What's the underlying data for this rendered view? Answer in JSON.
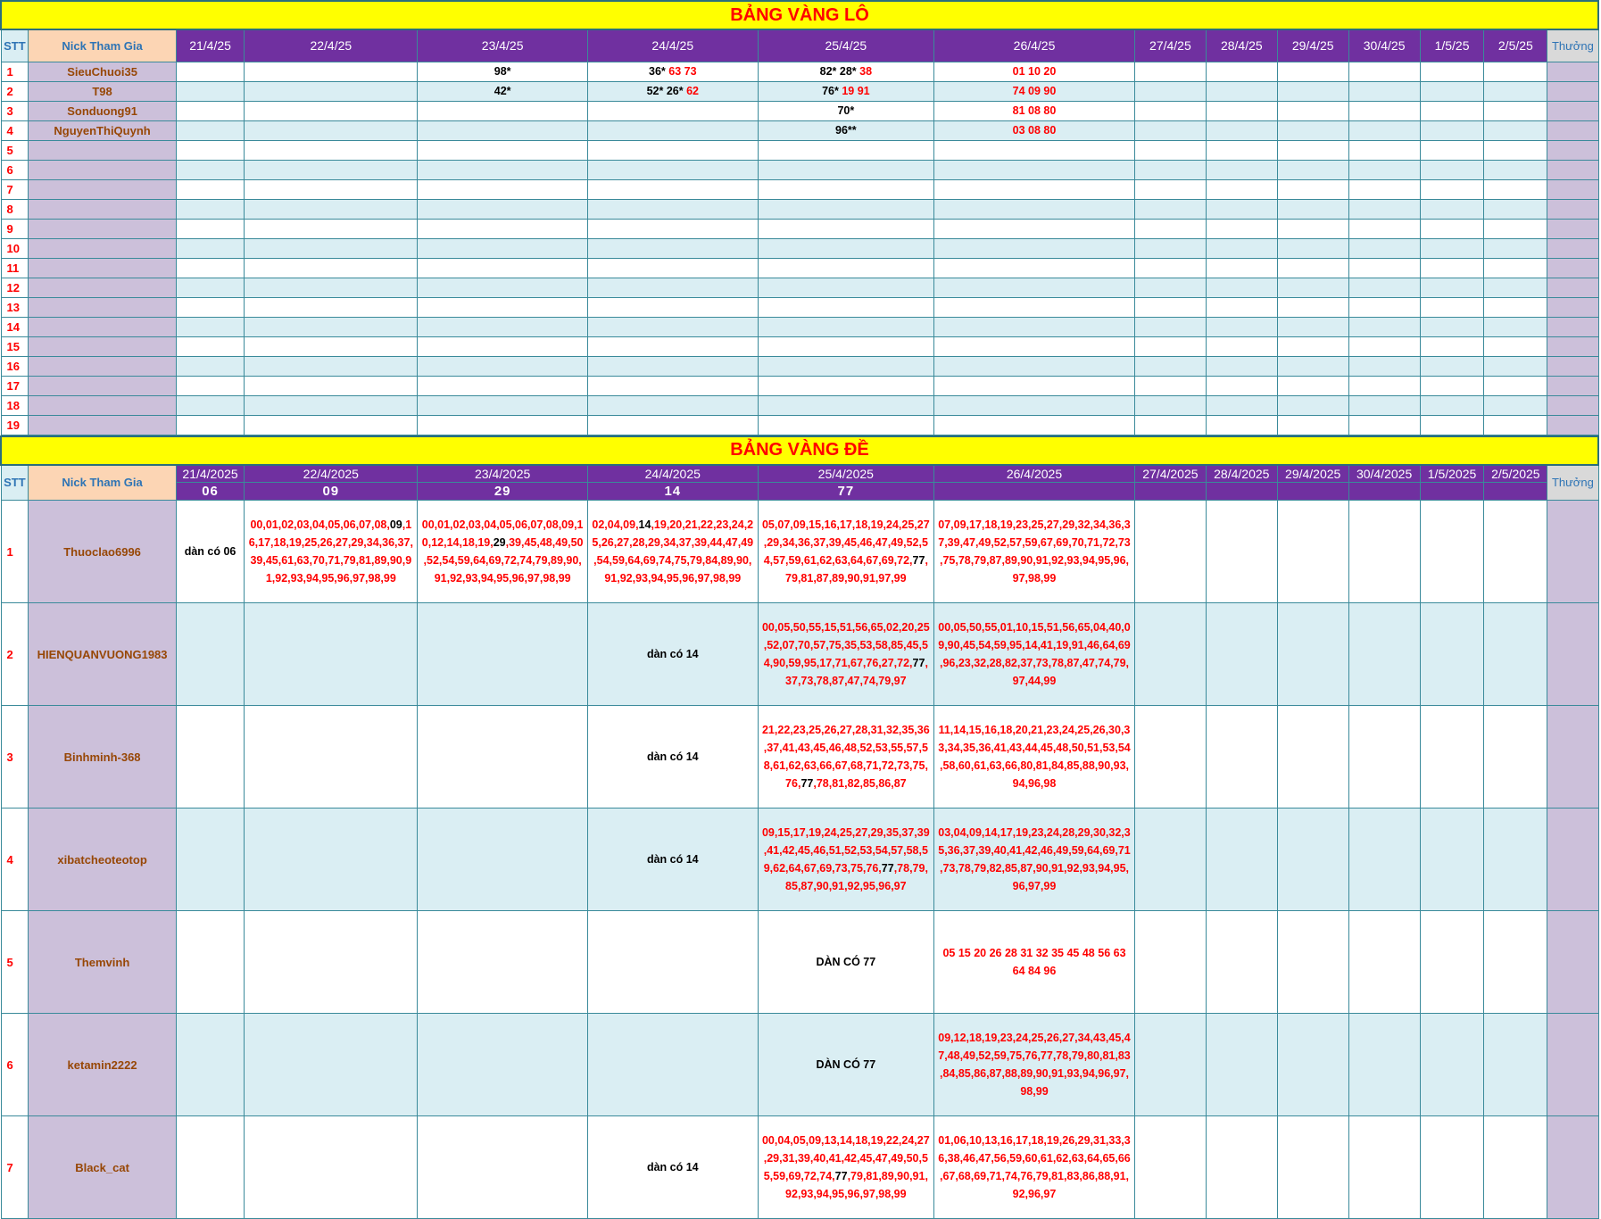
{
  "lo": {
    "title": "BẢNG VÀNG LÔ",
    "stt_header": "STT",
    "nick_header": "Nick Tham Gia",
    "prize_header": "Thưởng",
    "dates": [
      "21/4/25",
      "22/4/25",
      "23/4/25",
      "24/4/25",
      "25/4/25",
      "26/4/25",
      "27/4/25",
      "28/4/25",
      "29/4/25",
      "30/4/25",
      "1/5/25",
      "2/5/25"
    ],
    "rows": [
      {
        "stt": "1",
        "nick": "SieuChuoi35",
        "cells": [
          [],
          [],
          [
            [
              "98*",
              "blk"
            ]
          ],
          [
            [
              "36* ",
              "blk"
            ],
            [
              "63 73",
              "red"
            ]
          ],
          [
            [
              "82* 28* ",
              "blk"
            ],
            [
              "38",
              "red"
            ]
          ],
          [
            [
              "01 10 20",
              "red"
            ]
          ],
          [],
          [],
          [],
          [],
          [],
          []
        ]
      },
      {
        "stt": "2",
        "nick": "T98",
        "cells": [
          [],
          [],
          [
            [
              "42*",
              "blk"
            ]
          ],
          [
            [
              "52* 26* ",
              "blk"
            ],
            [
              "62",
              "red"
            ]
          ],
          [
            [
              "76* ",
              "blk"
            ],
            [
              "19 91",
              "red"
            ]
          ],
          [
            [
              "74 09 90",
              "red"
            ]
          ],
          [],
          [],
          [],
          [],
          [],
          []
        ]
      },
      {
        "stt": "3",
        "nick": "Sonduong91",
        "cells": [
          [],
          [],
          [],
          [],
          [
            [
              "70*",
              "blk"
            ]
          ],
          [
            [
              "81 08 80",
              "red"
            ]
          ],
          [],
          [],
          [],
          [],
          [],
          []
        ]
      },
      {
        "stt": "4",
        "nick": "NguyenThiQuynh",
        "cells": [
          [],
          [],
          [],
          [],
          [
            [
              "96**",
              "blk"
            ]
          ],
          [
            [
              "03 08 80",
              "red"
            ]
          ],
          [],
          [],
          [],
          [],
          [],
          []
        ]
      },
      {
        "stt": "5",
        "nick": "",
        "cells": []
      },
      {
        "stt": "6",
        "nick": "",
        "cells": []
      },
      {
        "stt": "7",
        "nick": "",
        "cells": []
      },
      {
        "stt": "8",
        "nick": "",
        "cells": []
      },
      {
        "stt": "9",
        "nick": "",
        "cells": []
      },
      {
        "stt": "10",
        "nick": "",
        "cells": []
      },
      {
        "stt": "11",
        "nick": "",
        "cells": []
      },
      {
        "stt": "12",
        "nick": "",
        "cells": []
      },
      {
        "stt": "13",
        "nick": "",
        "cells": []
      },
      {
        "stt": "14",
        "nick": "",
        "cells": []
      },
      {
        "stt": "15",
        "nick": "",
        "cells": []
      },
      {
        "stt": "16",
        "nick": "",
        "cells": []
      },
      {
        "stt": "17",
        "nick": "",
        "cells": []
      },
      {
        "stt": "18",
        "nick": "",
        "cells": []
      },
      {
        "stt": "19",
        "nick": "",
        "cells": []
      }
    ]
  },
  "de": {
    "title": "BẢNG VÀNG ĐỀ",
    "stt_header": "STT",
    "nick_header": "Nick Tham Gia",
    "prize_header": "Thưởng",
    "dates": [
      "21/4/2025",
      "22/4/2025",
      "23/4/2025",
      "24/4/2025",
      "25/4/2025",
      "26/4/2025",
      "27/4/2025",
      "28/4/2025",
      "29/4/2025",
      "30/4/2025",
      "1/5/2025",
      "2/5/2025"
    ],
    "results": [
      "06",
      "09",
      "29",
      "14",
      "77",
      "",
      "",
      "",
      "",
      "",
      "",
      ""
    ],
    "rows": [
      {
        "stt": "1",
        "nick": "Thuoclao6996",
        "cells": [
          [
            [
              "dàn có 06",
              "blk"
            ]
          ],
          [
            [
              "00,01,02,03,04,05,06,07,08,",
              "red"
            ],
            [
              "09",
              "blk"
            ],
            [
              ",16,17,18,19,25,26,27,29,34,36,37,39,45,61,63,70,71,79,81,89,90,91,92,93,94,95,96,97,98,99",
              "red"
            ]
          ],
          [
            [
              "00,01,02,03,04,05,06,07,08,09,10,12,14,18,19,",
              "red"
            ],
            [
              "29",
              "blk"
            ],
            [
              ",39,45,48,49,50,52,54,59,64,69,72,74,79,89,90,91,92,93,94,95,96,97,98,99",
              "red"
            ]
          ],
          [
            [
              "02,04,09,",
              "red"
            ],
            [
              "14",
              "blk"
            ],
            [
              ",19,20,21,22,23,24,25,26,27,28,29,34,37,39,44,47,49,54,59,64,69,74,75,79,84,89,90,91,92,93,94,95,96,97,98,99",
              "red"
            ]
          ],
          [
            [
              "05,07,09,15,16,17,18,19,24,25,27,29,34,36,37,39,45,46,47,49,52,54,57,59,61,62,63,64,67,69,72,",
              "red"
            ],
            [
              "77",
              "blk"
            ],
            [
              ",79,81,87,89,90,91,97,99",
              "red"
            ]
          ],
          [
            [
              "07,09,17,18,19,23,25,27,29,32,34,36,37,39,47,49,52,57,59,67,69,70,71,72,73,75,78,79,87,89,90,91,92,93,94,95,96,97,98,99",
              "red"
            ]
          ],
          [],
          [],
          [],
          [],
          [],
          []
        ]
      },
      {
        "stt": "2",
        "nick": "HIENQUANVUONG1983",
        "cells": [
          [],
          [],
          [],
          [
            [
              "dàn có 14",
              "blk"
            ]
          ],
          [
            [
              "00,05,50,55,15,51,56,65,02,20,25,52,07,70,57,75,35,53,58,85,45,54,90,59,95,17,71,67,76,27,72,",
              "red"
            ],
            [
              "77",
              "blk"
            ],
            [
              ",37,73,78,87,47,74,79,97",
              "red"
            ]
          ],
          [
            [
              "00,05,50,55,01,10,15,51,56,65,04,40,09,90,45,54,59,95,14,41,19,91,46,64,69,96,23,32,28,82,37,73,78,87,47,74,79,97,44,99",
              "red"
            ]
          ],
          [],
          [],
          [],
          [],
          [],
          []
        ]
      },
      {
        "stt": "3",
        "nick": "Binhminh-368",
        "cells": [
          [],
          [],
          [],
          [
            [
              "dàn có 14",
              "blk"
            ]
          ],
          [
            [
              "21,22,23,25,26,27,28,31,32,35,36,37,41,43,45,46,48,52,53,55,57,58,61,62,63,66,67,68,71,72,73,75,76,",
              "red"
            ],
            [
              "77",
              "blk"
            ],
            [
              ",78,81,82,85,86,87",
              "red"
            ]
          ],
          [
            [
              "11,14,15,16,18,20,21,23,24,25,26,30,33,34,35,36,41,43,44,45,48,50,51,53,54,58,60,61,63,66,80,81,84,85,88,90,93,94,96,98",
              "red"
            ]
          ],
          [],
          [],
          [],
          [],
          [],
          []
        ]
      },
      {
        "stt": "4",
        "nick": "xibatcheoteotop",
        "cells": [
          [],
          [],
          [],
          [
            [
              "dàn có 14",
              "blk"
            ]
          ],
          [
            [
              "09,15,17,19,24,25,27,29,35,37,39,41,42,45,46,51,52,53,54,57,58,59,62,64,67,69,73,75,76,",
              "red"
            ],
            [
              "77",
              "blk"
            ],
            [
              ",78,79,85,87,90,91,92,95,96,97",
              "red"
            ]
          ],
          [
            [
              "03,04,09,14,17,19,23,24,28,29,30,32,35,36,37,39,40,41,42,46,49,59,64,69,71,73,78,79,82,85,87,90,91,92,93,94,95,96,97,99",
              "red"
            ]
          ],
          [],
          [],
          [],
          [],
          [],
          []
        ]
      },
      {
        "stt": "5",
        "nick": "Themvinh",
        "cells": [
          [],
          [],
          [],
          [],
          [
            [
              "DÀN CÓ 77",
              "blk"
            ]
          ],
          [
            [
              "05 15 20 26 28 31 32 35 45 48 56 63 64 84 96",
              "red"
            ]
          ],
          [],
          [],
          [],
          [],
          [],
          []
        ]
      },
      {
        "stt": "6",
        "nick": "ketamin2222",
        "cells": [
          [],
          [],
          [],
          [],
          [
            [
              "DÀN CÓ 77",
              "blk"
            ]
          ],
          [
            [
              "09,12,18,19,23,24,25,26,27,34,43,45,47,48,49,52,59,75,76,77,78,79,80,81,83,84,85,86,87,88,89,90,91,93,94,96,97,98,99",
              "red"
            ]
          ],
          [],
          [],
          [],
          [],
          [],
          []
        ]
      },
      {
        "stt": "7",
        "nick": "Black_cat",
        "cells": [
          [],
          [],
          [],
          [
            [
              "dàn có 14",
              "blk"
            ]
          ],
          [
            [
              "00,04,05,09,13,14,18,19,22,24,27,29,31,39,40,41,42,45,47,49,50,55,59,69,72,74,",
              "red"
            ],
            [
              "77",
              "blk"
            ],
            [
              ",79,81,89,90,91,92,93,94,95,96,97,98,99",
              "red"
            ]
          ],
          [
            [
              "01,06,10,13,16,17,18,19,26,29,31,33,36,38,46,47,56,59,60,61,62,63,64,65,66,67,68,69,71,74,76,79,81,83,86,88,91,92,96,97",
              "red"
            ]
          ],
          [],
          [],
          [],
          [],
          [],
          []
        ]
      }
    ]
  }
}
